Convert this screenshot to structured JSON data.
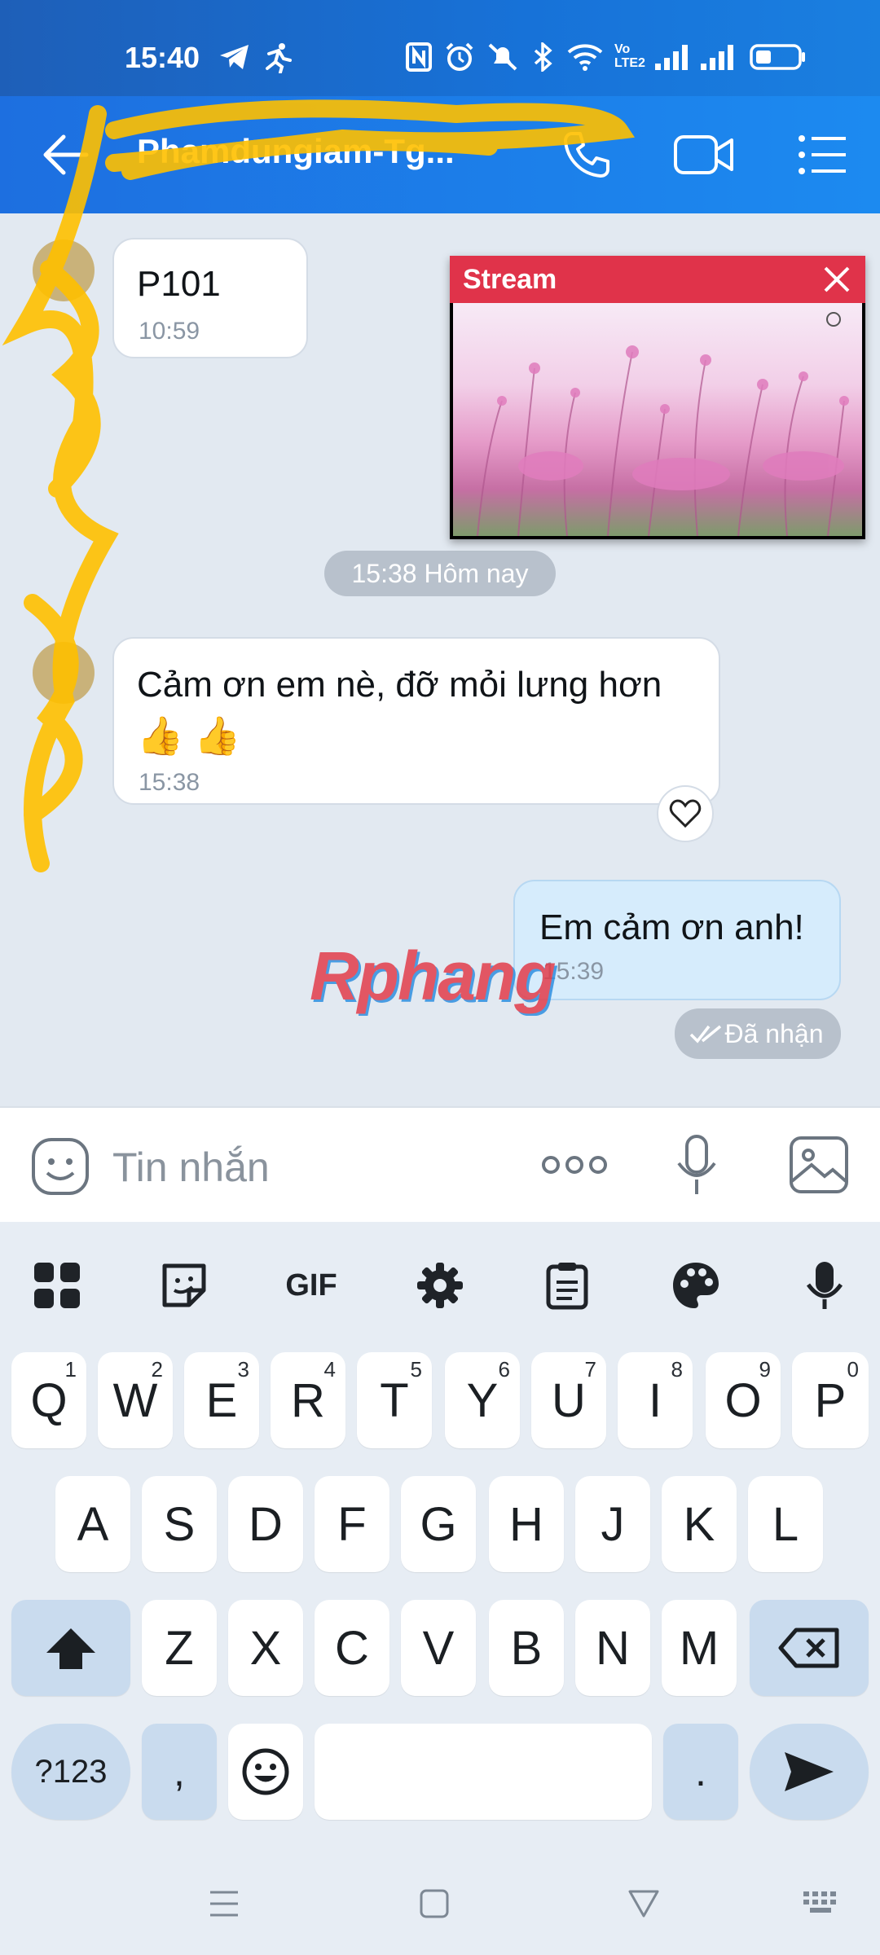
{
  "status_bar": {
    "time": "15:40",
    "icons": [
      "telegram-icon",
      "running-icon",
      "nfc-icon",
      "alarm-icon",
      "mute-icon",
      "bluetooth-icon",
      "wifi-icon",
      "volte-icon",
      "signal-icon",
      "signal-icon",
      "battery-icon"
    ],
    "volte_label": "Vo LTE2"
  },
  "header": {
    "back_icon": "arrow-left-icon",
    "title": "Phamdungiam-Tg...",
    "actions": [
      "phone-icon",
      "video-call-icon",
      "menu-list-icon"
    ]
  },
  "stream_popup": {
    "title": "Stream",
    "close_icon": "close-icon",
    "image": "pink-flower-field-image"
  },
  "messages": [
    {
      "side": "incoming",
      "text": "P101",
      "time": "10:59"
    },
    {
      "side": "incoming",
      "text": "Cảm ơn em nè, đỡ mỏi lưng hơn",
      "emoji": "👍 👍",
      "time": "15:38",
      "reaction_icon": "heart-icon"
    },
    {
      "side": "outgoing",
      "text": "Em cảm ơn anh!",
      "time": "15:39"
    }
  ],
  "date_separator": "15:38 Hôm nay",
  "delivery_status": "Đã nhận",
  "watermark": "Rphang",
  "input": {
    "placeholder": "Tin nhắn",
    "icons": [
      "sticker-face-icon",
      "more-dots-icon",
      "microphone-icon",
      "image-icon"
    ]
  },
  "keyboard": {
    "toolbar": [
      "grid-apps-icon",
      "sticker-icon",
      "gif-icon",
      "settings-gear-icon",
      "clipboard-icon",
      "palette-icon",
      "microphone-icon"
    ],
    "gif_label": "GIF",
    "row1": [
      {
        "key": "Q",
        "hint": "1"
      },
      {
        "key": "W",
        "hint": "2"
      },
      {
        "key": "E",
        "hint": "3"
      },
      {
        "key": "R",
        "hint": "4"
      },
      {
        "key": "T",
        "hint": "5"
      },
      {
        "key": "Y",
        "hint": "6"
      },
      {
        "key": "U",
        "hint": "7"
      },
      {
        "key": "I",
        "hint": "8"
      },
      {
        "key": "O",
        "hint": "9"
      },
      {
        "key": "P",
        "hint": "0"
      }
    ],
    "row2": [
      "A",
      "S",
      "D",
      "F",
      "G",
      "H",
      "J",
      "K",
      "L"
    ],
    "row3": [
      "Z",
      "X",
      "C",
      "V",
      "B",
      "N",
      "M"
    ],
    "symbols_label": "?123",
    "comma": ",",
    "period": "."
  },
  "nav_bar": [
    "recents-menu-icon",
    "home-square-icon",
    "back-triangle-icon",
    "keyboard-switch-icon"
  ]
}
